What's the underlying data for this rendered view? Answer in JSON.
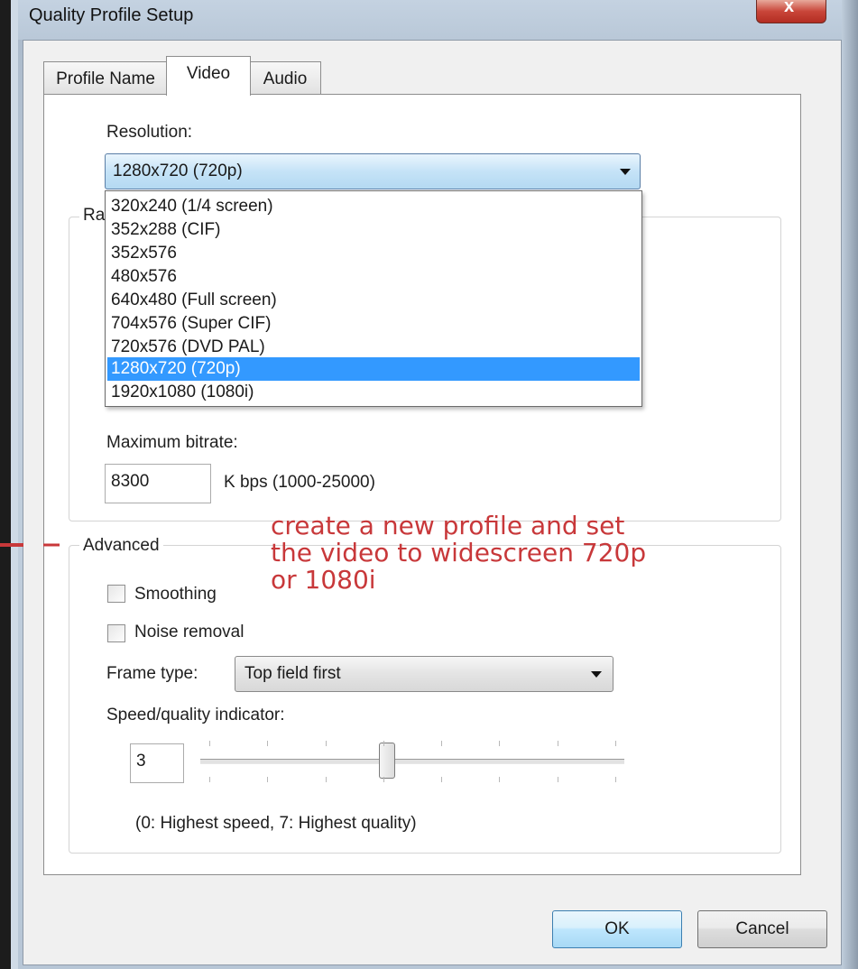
{
  "window": {
    "title": "Quality Profile Setup",
    "close_glyph": "x"
  },
  "tabs": [
    {
      "label": "Profile Name",
      "active": false
    },
    {
      "label": "Video",
      "active": true
    },
    {
      "label": "Audio",
      "active": false
    }
  ],
  "resolution": {
    "label": "Resolution:",
    "selected": "1280x720 (720p)",
    "options": [
      "320x240 (1/4 screen)",
      "352x288 (CIF)",
      "352x576",
      "480x576",
      "640x480 (Full screen)",
      "704x576 (Super CIF)",
      "720x576 (DVD PAL)",
      "1280x720 (720p)",
      "1920x1080 (1080i)"
    ],
    "selected_index": 7
  },
  "rate_group": {
    "legend_partial": "Ra",
    "max_bitrate_label": "Maximum bitrate:",
    "max_bitrate_value": "8300",
    "max_bitrate_unit": "K bps (1000-25000)"
  },
  "advanced": {
    "legend": "Advanced",
    "smoothing_label": "Smoothing",
    "smoothing_checked": false,
    "noise_label": "Noise removal",
    "noise_checked": false,
    "frame_type_label": "Frame type:",
    "frame_type_value": "Top field first",
    "speed_label": "Speed/quality indicator:",
    "speed_value": "3",
    "speed_min": 0,
    "speed_max": 7,
    "speed_hint": "(0: Highest speed, 7: Highest quality)"
  },
  "annotation": {
    "lines": [
      "create a new profile and set",
      "the video to widescreen 720p",
      "or 1080i"
    ],
    "color": "#c8383a"
  },
  "buttons": {
    "ok": "OK",
    "cancel": "Cancel"
  },
  "colors": {
    "selection": "#3399ff",
    "annotation": "#c8383a"
  }
}
